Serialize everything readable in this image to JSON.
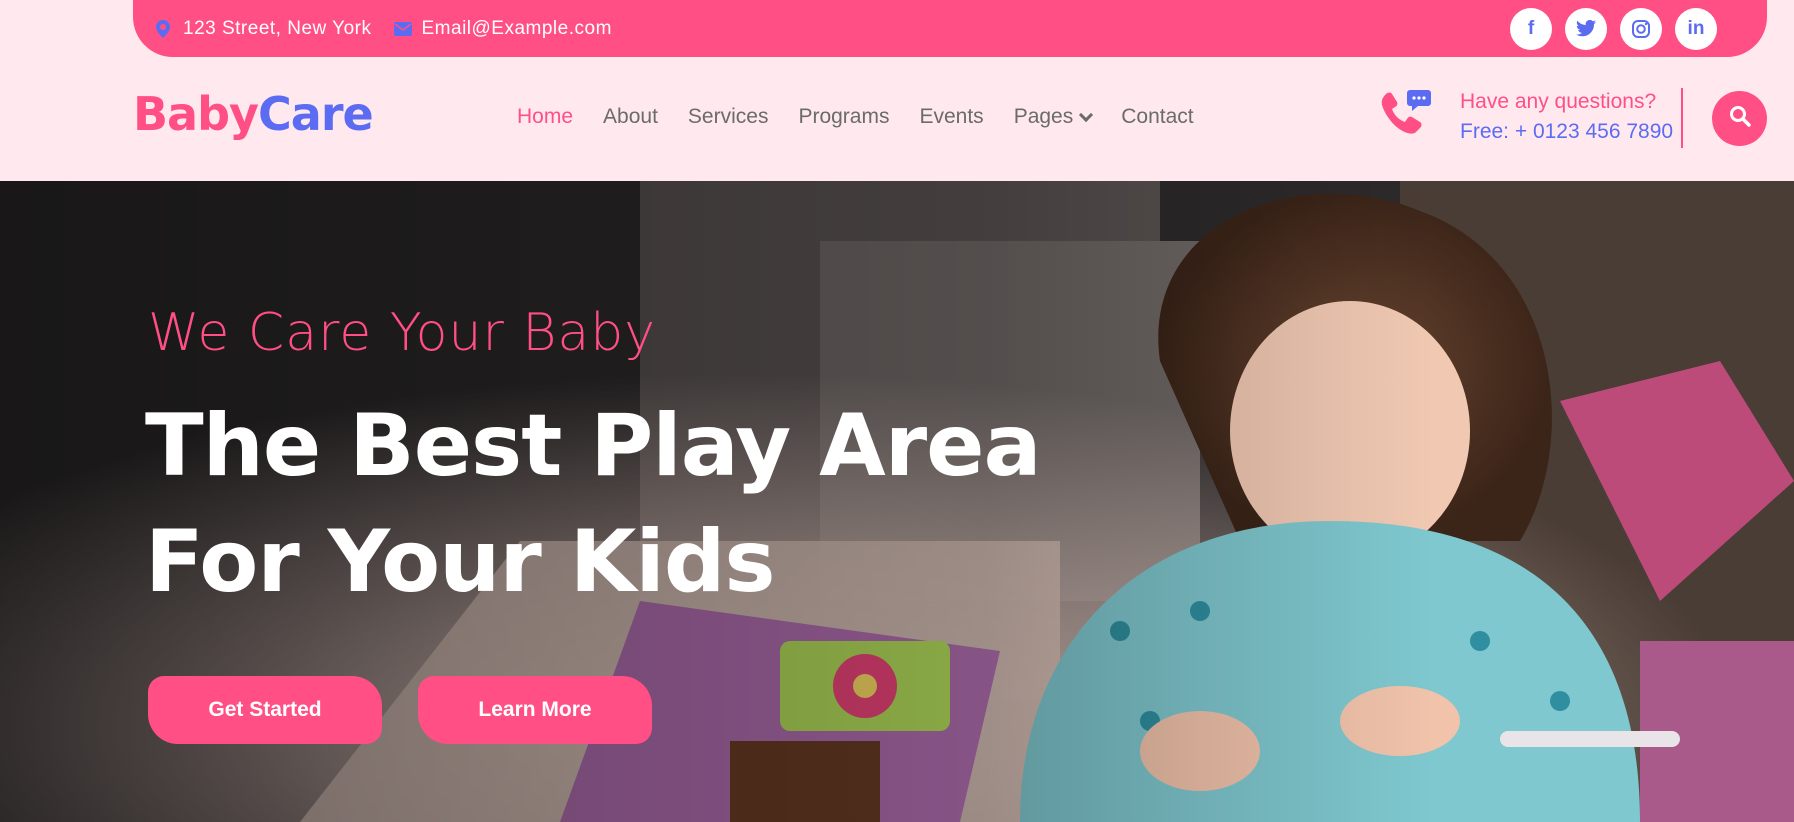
{
  "topbar": {
    "address": "123 Street, New York",
    "email": "Email@Example.com",
    "socials": [
      {
        "icon": "facebook-icon",
        "glyph": "f"
      },
      {
        "icon": "twitter-icon",
        "glyph": "t"
      },
      {
        "icon": "instagram-icon",
        "glyph": "◎"
      },
      {
        "icon": "linkedin-icon",
        "glyph": "in"
      }
    ]
  },
  "logo": {
    "part1": "Baby",
    "part2": "Care"
  },
  "menu": {
    "home": "Home",
    "about": "About",
    "services": "Services",
    "programs": "Programs",
    "events": "Events",
    "pages": "Pages",
    "contact": "Contact"
  },
  "question": {
    "line1": "Have any questions?",
    "line2": "Free: + 0123 456 7890"
  },
  "hero": {
    "tagline": "We Care Your Baby",
    "headline": "The Best Play Area For Your Kids",
    "primary_button": "Get Started",
    "secondary_button": "Learn More"
  },
  "colors": {
    "pink": "#ff4f84",
    "blue": "#5b6cf3",
    "background": "#ffe9ef"
  }
}
